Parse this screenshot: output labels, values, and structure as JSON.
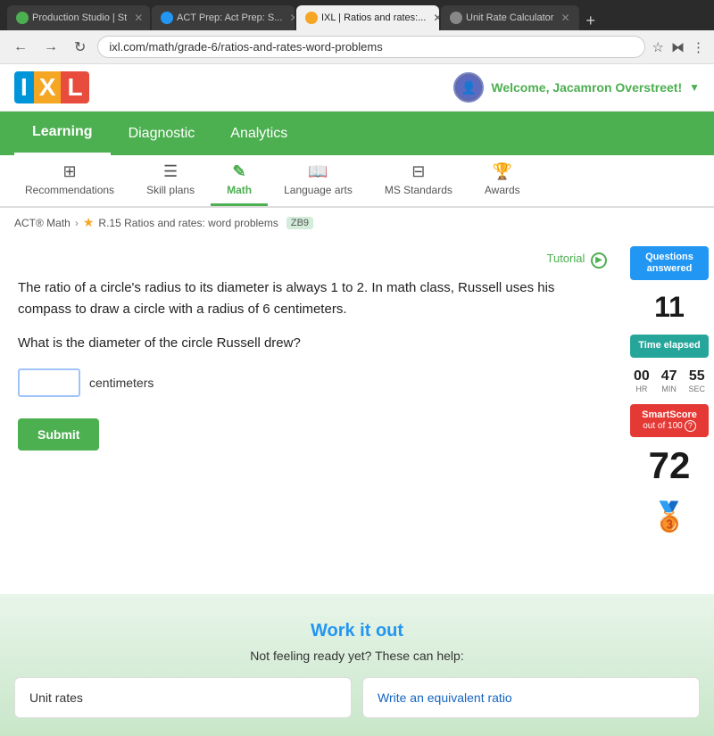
{
  "browser": {
    "tabs": [
      {
        "id": "prod-studio",
        "label": "Production Studio | St",
        "active": false,
        "color": "#4CAF50",
        "closable": true
      },
      {
        "id": "act-prep",
        "label": "ACT Prep: Act Prep: S...",
        "active": false,
        "color": "#2196F3",
        "closable": true
      },
      {
        "id": "ixl-ratios",
        "label": "IXL | Ratios and rates:...",
        "active": true,
        "color": "#f5a623",
        "closable": true
      },
      {
        "id": "unit-rate-calc",
        "label": "Unit Rate Calculator",
        "active": false,
        "color": "#555",
        "closable": true
      }
    ],
    "address": "ixl.com/math/grade-6/ratios-and-rates-word-problems",
    "new_tab_label": "+"
  },
  "header": {
    "logo": {
      "i": "I",
      "x": "X",
      "l": "L"
    },
    "welcome": "Welcome, Jacamron Overstreet!",
    "dropdown_arrow": "▼"
  },
  "nav": {
    "items": [
      {
        "id": "learning",
        "label": "Learning",
        "active": true
      },
      {
        "id": "diagnostic",
        "label": "Diagnostic",
        "active": false
      },
      {
        "id": "analytics",
        "label": "Analytics",
        "active": false
      }
    ]
  },
  "sub_nav": {
    "items": [
      {
        "id": "recommendations",
        "label": "Recommendations",
        "icon": "⊞",
        "active": false
      },
      {
        "id": "skill-plans",
        "label": "Skill plans",
        "icon": "☰",
        "active": false
      },
      {
        "id": "math",
        "label": "Math",
        "icon": "✎",
        "active": true
      },
      {
        "id": "language-arts",
        "label": "Language arts",
        "icon": "📖",
        "active": false
      },
      {
        "id": "ms-standards",
        "label": "MS Standards",
        "icon": "⊟",
        "active": false
      },
      {
        "id": "awards",
        "label": "Awards",
        "icon": "🏆",
        "active": false
      }
    ]
  },
  "breadcrumb": {
    "parent": "ACT® Math",
    "current": "R.15 Ratios and rates: word problems",
    "code": "ZB9"
  },
  "tutorial": {
    "label": "Tutorial",
    "play_icon": "▶"
  },
  "question": {
    "text": "The ratio of a circle's radius to its diameter is always 1 to 2. In math class, Russell uses his compass to draw a circle with a radius of 6 centimeters.",
    "sub_text": "What is the diameter of the circle Russell drew?",
    "answer_placeholder": "",
    "unit_label": "centimeters",
    "submit_label": "Submit"
  },
  "stats": {
    "questions_answered_label": "Questions answered",
    "questions_value": "11",
    "time_elapsed_label": "Time elapsed",
    "time": {
      "hr": "00",
      "min": "47",
      "sec": "55",
      "hr_label": "HR",
      "min_label": "MIN",
      "sec_label": "SEC"
    },
    "smart_score_label": "SmartScore",
    "smart_score_sub": "out of 100",
    "smart_score_help": "?",
    "smart_score_value": "72",
    "medal_icon": "🥉"
  },
  "work_it_out": {
    "title": "Work it out",
    "subtitle": "Not feeling ready yet? These can help:",
    "cards": [
      {
        "id": "unit-rates",
        "label": "Unit rates",
        "color": "default"
      },
      {
        "id": "write-equiv-ratio",
        "label": "Write an equivalent ratio",
        "color": "blue"
      }
    ]
  }
}
